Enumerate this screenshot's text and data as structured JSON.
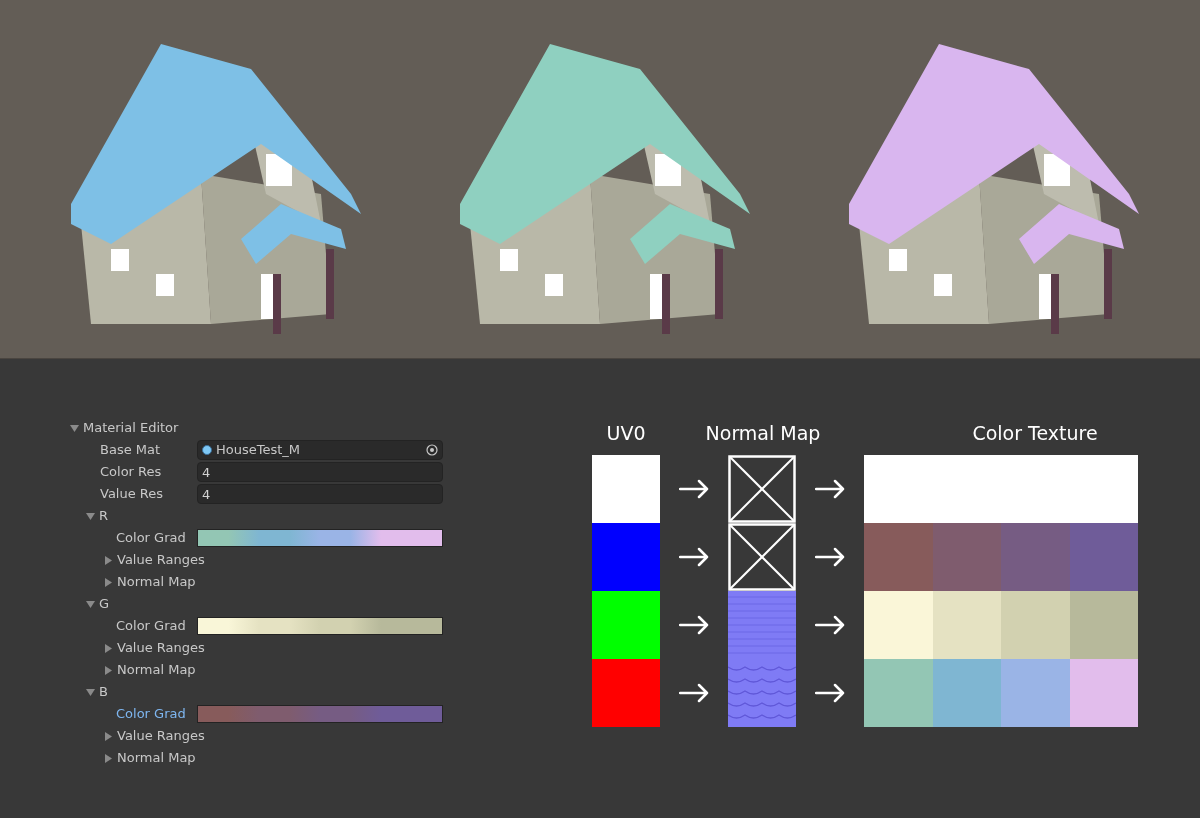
{
  "renders": [
    {
      "color": "#7ec0e6"
    },
    {
      "color": "#8fd0c0"
    },
    {
      "color": "#d9b6ef"
    }
  ],
  "material_editor": {
    "title": "Material Editor",
    "expanded": true,
    "fields": [
      {
        "label": "Base Mat",
        "kind": "object",
        "value": "HouseTest_M"
      },
      {
        "label": "Color Res",
        "kind": "number",
        "value": "4"
      },
      {
        "label": "Value Res",
        "kind": "number",
        "value": "4"
      }
    ],
    "channels": [
      {
        "label": "R",
        "expanded": true,
        "children": [
          {
            "label": "Color Grad",
            "kind": "gradient",
            "selected": false,
            "stops": [
              {
                "color": "#93c6b4"
              },
              {
                "color": "#7fb6d2"
              },
              {
                "color": "#9ab4e6"
              },
              {
                "color": "#e2bdec"
              }
            ]
          },
          {
            "label": "Value Ranges",
            "kind": "foldout",
            "expanded": false
          },
          {
            "label": "Normal Map",
            "kind": "foldout",
            "expanded": false
          }
        ]
      },
      {
        "label": "G",
        "expanded": true,
        "children": [
          {
            "label": "Color Grad",
            "kind": "gradient",
            "selected": false,
            "stops": [
              {
                "color": "#f9f6d8"
              },
              {
                "color": "#e5e2c2"
              },
              {
                "color": "#d2d1b0"
              },
              {
                "color": "#b7b99b"
              }
            ]
          },
          {
            "label": "Value Ranges",
            "kind": "foldout",
            "expanded": false
          },
          {
            "label": "Normal Map",
            "kind": "foldout",
            "expanded": false
          }
        ]
      },
      {
        "label": "B",
        "expanded": true,
        "children": [
          {
            "label": "Color Grad",
            "kind": "gradient",
            "selected": true,
            "stops": [
              {
                "color": "#875b5b"
              },
              {
                "color": "#7f5c6e"
              },
              {
                "color": "#765c83"
              },
              {
                "color": "#6f5c99"
              }
            ]
          },
          {
            "label": "Value Ranges",
            "kind": "foldout",
            "expanded": false
          },
          {
            "label": "Normal Map",
            "kind": "foldout",
            "expanded": false
          }
        ]
      }
    ]
  },
  "diagram": {
    "headers": [
      "UV0",
      "Normal Map",
      "Color Texture"
    ],
    "rows": [
      {
        "uv": {
          "color": "#ffffff"
        },
        "kind": "empty",
        "cells": [
          {
            "color": "#ffffff"
          }
        ]
      },
      {
        "uv": {
          "color": "#0000ff"
        },
        "kind": "empty",
        "cells": [
          {
            "color": "#875b5b"
          },
          {
            "color": "#7f5c6e"
          },
          {
            "color": "#765c83"
          },
          {
            "color": "#6f5c99"
          }
        ]
      },
      {
        "uv": {
          "color": "#00ff00"
        },
        "kind": "stripes",
        "cells": [
          {
            "color": "#faf6d8"
          },
          {
            "color": "#e5e2c2"
          },
          {
            "color": "#d2d1b0"
          },
          {
            "color": "#b7b99b"
          }
        ]
      },
      {
        "uv": {
          "color": "#ff0000"
        },
        "kind": "waves",
        "cells": [
          {
            "color": "#93c6b4"
          },
          {
            "color": "#7fb6d2"
          },
          {
            "color": "#9ab4e6"
          },
          {
            "color": "#e2bdec"
          }
        ]
      }
    ]
  }
}
